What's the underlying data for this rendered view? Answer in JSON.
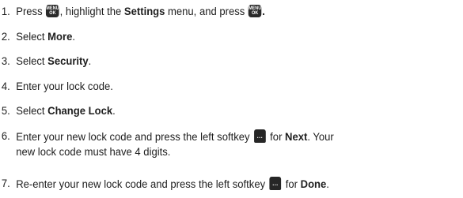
{
  "steps": [
    {
      "num": "1.",
      "t1": "Press ",
      "key1_top": "MENU",
      "key1_bottom": "OK",
      "t2": ", highlight the ",
      "b1": "Settings",
      "t3": " menu, and press ",
      "key2_top": "MENU",
      "key2_bottom": "OK",
      "b2": "."
    },
    {
      "num": "2.",
      "t1": "Select ",
      "b1": "More",
      "t2": "."
    },
    {
      "num": "3.",
      "t1": "Select ",
      "b1": "Security",
      "t2": "."
    },
    {
      "num": "4.",
      "t1": "Enter your lock code."
    },
    {
      "num": "5.",
      "t1": "Select ",
      "b1": "Change Lock",
      "t2": "."
    },
    {
      "num": "6.",
      "t1": "Enter your new lock code and press the left softkey ",
      "softkey_glyph": "···",
      "t2": " for ",
      "b1": "Next",
      "t3": ". Your",
      "line2": "new lock code must have 4 digits."
    },
    {
      "num": "7.",
      "t1": "Re-enter your new lock code and press the left softkey ",
      "softkey_glyph": "···",
      "t2": " for ",
      "b1": "Done",
      "t3": "."
    }
  ],
  "icons": {
    "menu_ok_key": "menu-ok-key-icon",
    "left_softkey": "left-softkey-icon"
  },
  "colors": {
    "text": "#1e1e1e",
    "key_fill": "#2a2a2a",
    "key_text": "#ffffff"
  }
}
